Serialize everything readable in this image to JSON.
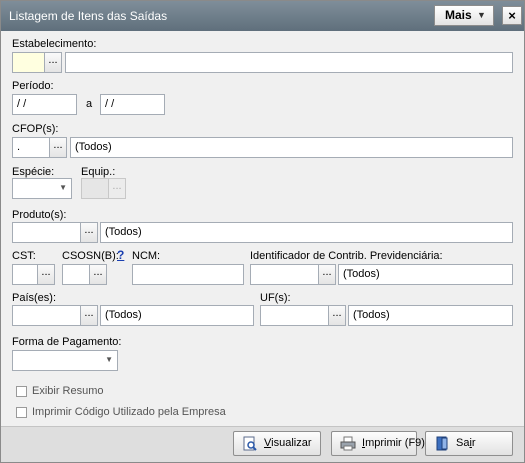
{
  "window": {
    "title": "Listagem de Itens das Saídas",
    "mais_label": "Mais",
    "close_label": "×"
  },
  "form": {
    "estabelecimento": {
      "label": "Estabelecimento:",
      "code": "",
      "lookup": "...",
      "name": ""
    },
    "periodo": {
      "label": "Período:",
      "start": " /  /",
      "sep": "a",
      "end": " /  /"
    },
    "cfop": {
      "label": "CFOP(s):",
      "code": ".",
      "lookup": "...",
      "desc": "(Todos)"
    },
    "especie": {
      "label": "Espécie:",
      "value": ""
    },
    "equip": {
      "label": "Equip.:",
      "lookup": "..."
    },
    "produto": {
      "label": "Produto(s):",
      "code": "",
      "lookup": "...",
      "desc": "(Todos)"
    },
    "cst": {
      "label": "CST:",
      "lookup": "..."
    },
    "csosn": {
      "label": "CSOSN(B):",
      "help": "?",
      "lookup": "..."
    },
    "ncm": {
      "label": "NCM:",
      "value": ""
    },
    "contrib": {
      "label": "Identificador de Contrib. Previdenciária:",
      "lookup": "...",
      "desc": "(Todos)"
    },
    "paises": {
      "label": "País(es):",
      "lookup": "...",
      "desc": "(Todos)"
    },
    "ufs": {
      "label": "UF(s):",
      "lookup": "...",
      "desc": "(Todos)"
    },
    "forma_pagamento": {
      "label": "Forma de Pagamento:",
      "value": ""
    },
    "exibir_resumo": {
      "label": "Exibir Resumo",
      "checked": false
    },
    "imprimir_codigo": {
      "label": "Imprimir Código Utilizado pela Empresa",
      "checked": false
    }
  },
  "buttons": {
    "visualizar": {
      "first": "V",
      "rest": "isualizar"
    },
    "imprimir": {
      "first": "I",
      "rest": "mprimir (F9)"
    },
    "sair": {
      "first": "Sa",
      "u": "i",
      "rest": "r"
    }
  }
}
